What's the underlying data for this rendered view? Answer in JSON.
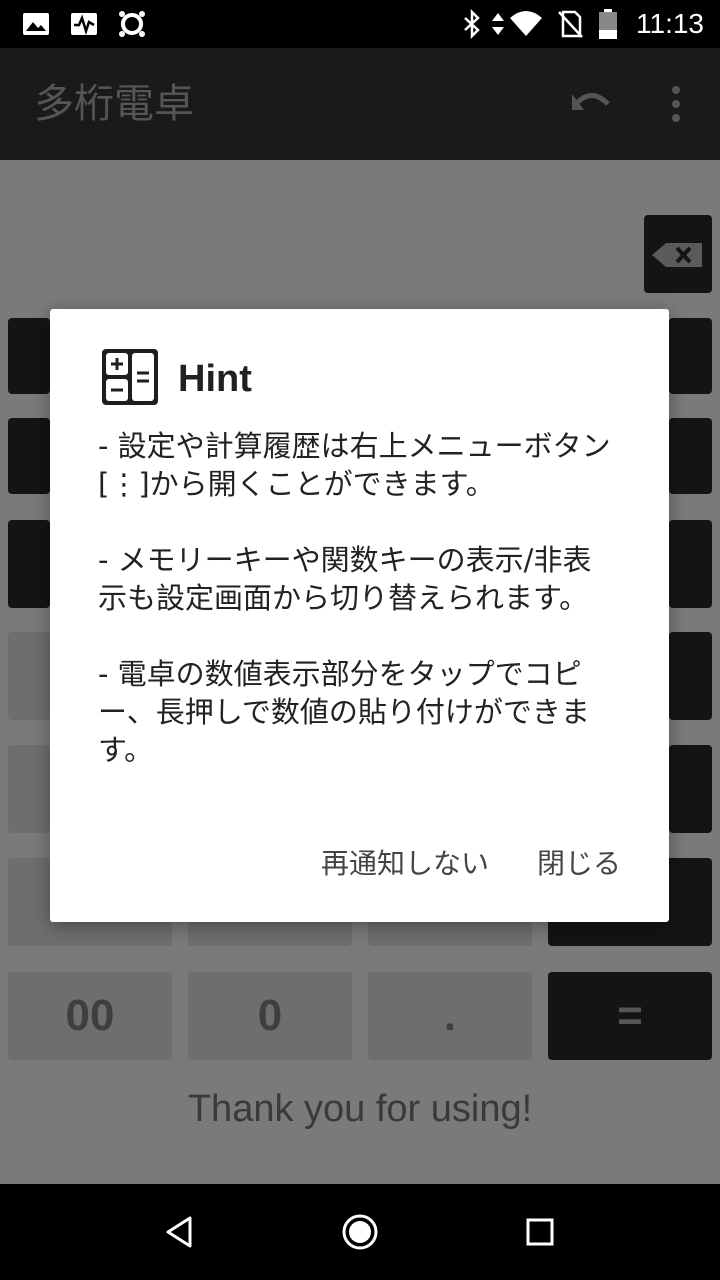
{
  "status": {
    "time": "11:13"
  },
  "app": {
    "title": "多桁電卓"
  },
  "keys": {
    "double_zero": "00",
    "zero": "0",
    "dot": ".",
    "equals": "="
  },
  "footer": {
    "thanks": "Thank you for using!"
  },
  "dialog": {
    "title": "Hint",
    "paragraphs": [
      "- 設定や計算履歴は右上メニューボタン[⋮]から開くことができます。",
      "- メモリーキーや関数キーの表示/非表示も設定画面から切り替えられます。",
      "- 電卓の数値表示部分をタップでコピー、長押しで数値の貼り付けができます。"
    ],
    "dont_show_again": "再通知しない",
    "close": "閉じる"
  },
  "colors": {
    "accent": "#ffffff",
    "scrim": "#7a7a7a",
    "dark_key": "#141414"
  }
}
